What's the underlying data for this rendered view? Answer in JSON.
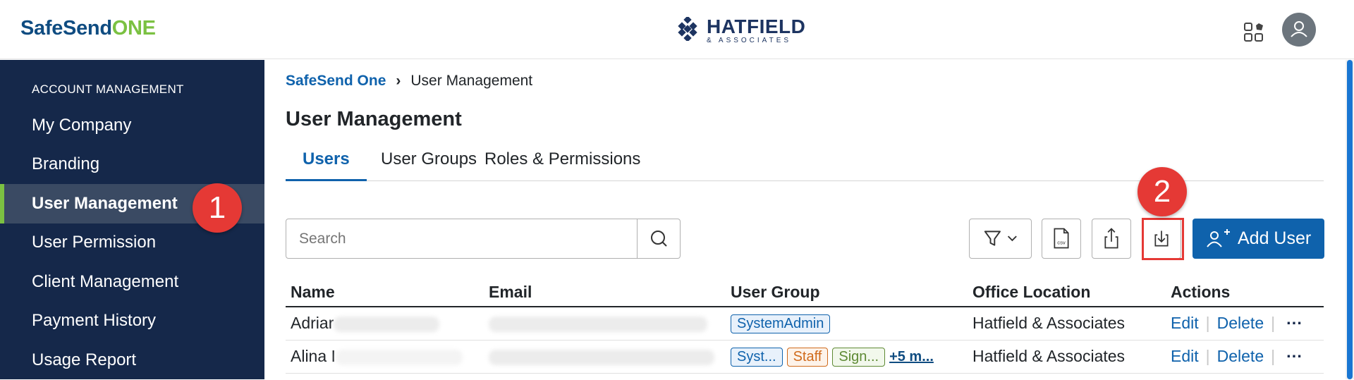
{
  "brand": {
    "part1": "SafeSend",
    "part2": "ONE"
  },
  "company_logo": {
    "name": "HATFIELD",
    "sub": "& ASSOCIATES"
  },
  "sidebar": {
    "heading": "ACCOUNT MANAGEMENT",
    "items": [
      {
        "label": "My Company"
      },
      {
        "label": "Branding"
      },
      {
        "label": "User Management",
        "active": true
      },
      {
        "label": "User Permission"
      },
      {
        "label": "Client Management"
      },
      {
        "label": "Payment History"
      },
      {
        "label": "Usage Report"
      }
    ]
  },
  "badges": {
    "one": "1",
    "two": "2"
  },
  "breadcrumb": {
    "root": "SafeSend One",
    "separator": "›",
    "current": "User Management"
  },
  "page_title": "User Management",
  "tabs": [
    {
      "label": "Users"
    },
    {
      "label": "User Groups"
    },
    {
      "label": "Roles & Permissions"
    }
  ],
  "search": {
    "placeholder": "Search"
  },
  "toolbar": {
    "add_user_label": "Add User",
    "csv_label": "csv"
  },
  "table": {
    "headers": [
      "Name",
      "Email",
      "User Group",
      "Office Location",
      "Actions"
    ],
    "rows": [
      {
        "name": "Adriar",
        "groups": [
          "SystemAdmin"
        ],
        "office": "Hatfield & Associates",
        "edit": "Edit",
        "delete": "Delete"
      },
      {
        "name": "Alina I",
        "groups": [
          "Syst...",
          "Staff",
          "Sign..."
        ],
        "more": "+5 m...",
        "office": "Hatfield & Associates",
        "edit": "Edit",
        "delete": "Delete"
      }
    ]
  },
  "colors": {
    "brand_blue": "#0f4c81",
    "brand_green": "#7bc142",
    "sidebar_bg": "#15284a",
    "primary": "#0f62ac",
    "badge_red": "#e53935"
  },
  "icons": [
    "apps-icon",
    "user-avatar-icon",
    "search-icon",
    "filter-icon",
    "chevron-down-icon",
    "csv-icon",
    "upload-icon",
    "download-icon",
    "add-user-icon",
    "more-icon"
  ]
}
